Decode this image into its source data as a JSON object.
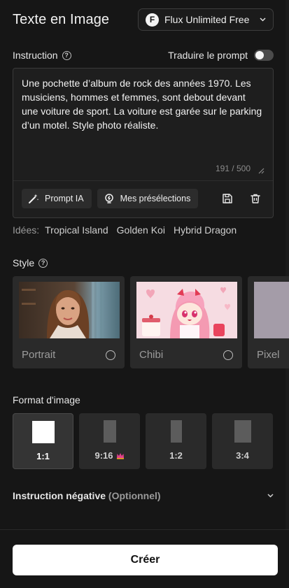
{
  "header": {
    "title": "Texte en Image",
    "model": {
      "logo_letter": "F",
      "name": "Flux Unlimited Free"
    }
  },
  "instruction": {
    "label": "Instruction",
    "translate_label": "Traduire le prompt",
    "translate_enabled": false,
    "prompt": "Une pochette d’album de rock des années 1970. Les musiciens, hommes et femmes, sont debout devant une voiture de sport. La voiture est garée sur le parking d’un motel. Style photo réaliste.",
    "counter": "191 / 500",
    "actions": {
      "prompt_ai": "Prompt IA",
      "presets": "Mes présélections"
    }
  },
  "ideas": {
    "label": "Idées:",
    "items": [
      "Tropical Island",
      "Golden Koi",
      "Hybrid Dragon"
    ]
  },
  "style": {
    "label": "Style",
    "cards": [
      {
        "name": "Portrait",
        "selected": false
      },
      {
        "name": "Chibi",
        "selected": false
      },
      {
        "name": "Pixel",
        "selected": false
      }
    ]
  },
  "format": {
    "label": "Format d'image",
    "options": [
      {
        "label": "1:1",
        "selected": true,
        "premium": false
      },
      {
        "label": "9:16",
        "selected": false,
        "premium": true
      },
      {
        "label": "1:2",
        "selected": false,
        "premium": false
      },
      {
        "label": "3:4",
        "selected": false,
        "premium": false
      }
    ]
  },
  "negative": {
    "title": "Instruction négative",
    "optional": "(Optionnel)"
  },
  "create_label": "Créer",
  "colors": {
    "background": "#161616",
    "accent_premium": "#e0408a",
    "button": "#ffffff"
  }
}
